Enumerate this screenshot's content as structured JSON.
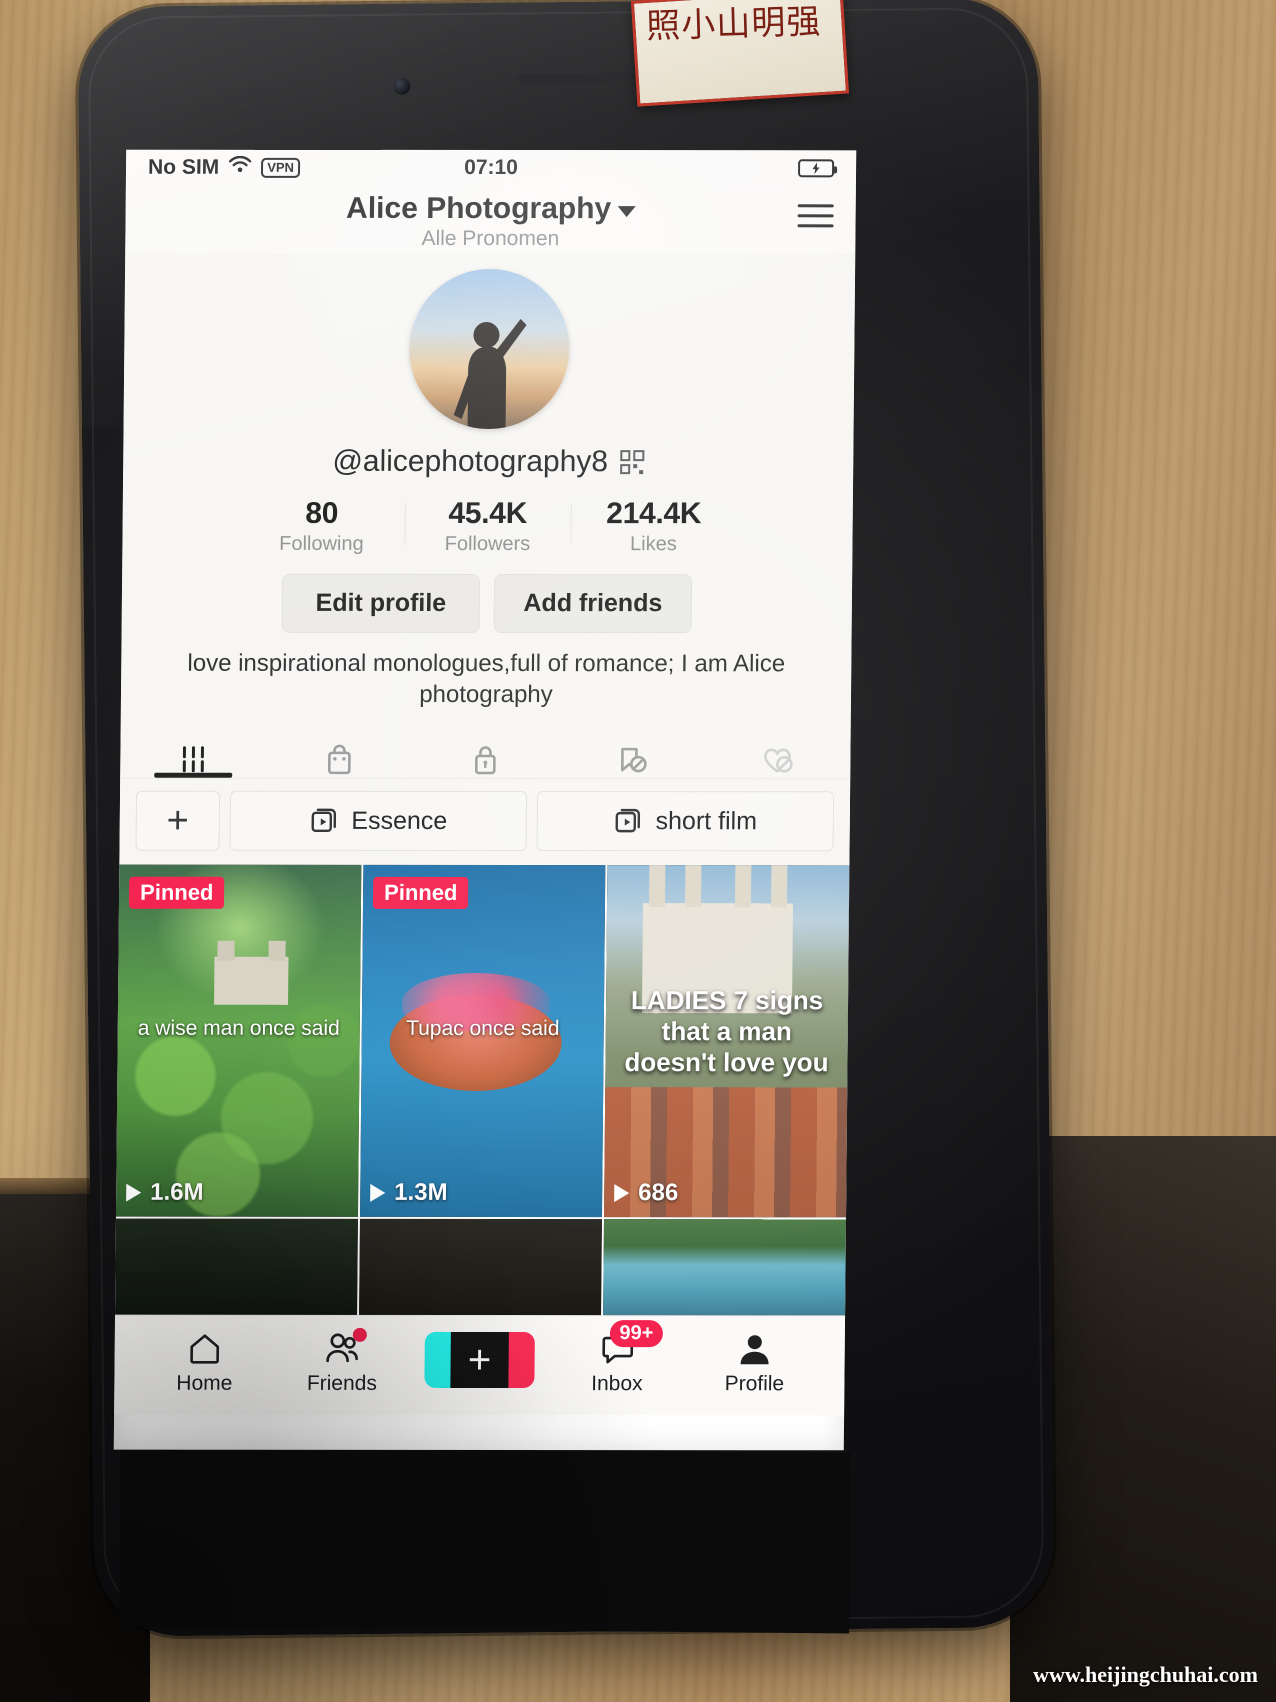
{
  "status_bar": {
    "carrier": "No SIM",
    "wifi_icon": "wifi-icon",
    "vpn_label": "VPN",
    "time": "07:10",
    "battery_icon": "battery-charging-icon"
  },
  "header": {
    "title": "Alice Photography",
    "dropdown_icon": "chevron-down-icon",
    "pronouns": "Alle Pronomen",
    "menu_icon": "hamburger-menu-icon"
  },
  "profile": {
    "avatar_alt": "avatar",
    "handle": "@alicephotography8",
    "qr_icon": "qr-code-icon",
    "stats": [
      {
        "value": "80",
        "label": "Following"
      },
      {
        "value": "45.4K",
        "label": "Followers"
      },
      {
        "value": "214.4K",
        "label": "Likes"
      }
    ],
    "actions": [
      {
        "label": "Edit profile"
      },
      {
        "label": "Add friends"
      }
    ],
    "bio": "love inspirational monologues,full of romance; I am Alice photography"
  },
  "content_tabs": [
    {
      "icon": "grid-icon",
      "name": "posts",
      "active": true
    },
    {
      "icon": "shopping-bag-icon",
      "name": "shop",
      "active": false
    },
    {
      "icon": "lock-icon",
      "name": "private",
      "active": false
    },
    {
      "icon": "bookmark-slash-icon",
      "name": "saved",
      "active": false
    },
    {
      "icon": "heart-slash-icon",
      "name": "liked",
      "active": false
    }
  ],
  "playlists": {
    "add_label": "+",
    "items": [
      {
        "icon": "playlist-icon",
        "label": "Essence"
      },
      {
        "icon": "playlist-icon",
        "label": "short film"
      }
    ]
  },
  "video_grid": [
    {
      "pinned_label": "Pinned",
      "caption": "a wise man once said",
      "views": "1.6M",
      "art": "art-forest",
      "caption_style": "plain"
    },
    {
      "pinned_label": "Pinned",
      "caption": "Tupac once said",
      "views": "1.3M",
      "art": "art-lake",
      "caption_style": "plain"
    },
    {
      "pinned_label": "",
      "caption": "LADIES 7 signs that a man doesn't love you",
      "views": "686",
      "art": "art-city",
      "caption_style": "bold"
    }
  ],
  "video_grid_row2": [
    {
      "art": "art-dark"
    },
    {
      "art": "art-dark2"
    },
    {
      "art": "art-river"
    }
  ],
  "bottom_nav": [
    {
      "icon": "home-icon",
      "label": "Home",
      "badge": "",
      "dot": false
    },
    {
      "icon": "friends-icon",
      "label": "Friends",
      "badge": "",
      "dot": true
    },
    {
      "icon": "create-icon",
      "label": "",
      "badge": "",
      "dot": false
    },
    {
      "icon": "inbox-icon",
      "label": "Inbox",
      "badge": "99+",
      "dot": false
    },
    {
      "icon": "profile-icon",
      "label": "Profile",
      "badge": "",
      "dot": false
    }
  ],
  "device": {
    "sticker_text": "照小山明强"
  },
  "watermark": "www.heijingchuhai.com",
  "colors": {
    "accent_red": "#f4204e",
    "cyan": "#25f4ee",
    "screen_bg": "#f7f6f3"
  }
}
